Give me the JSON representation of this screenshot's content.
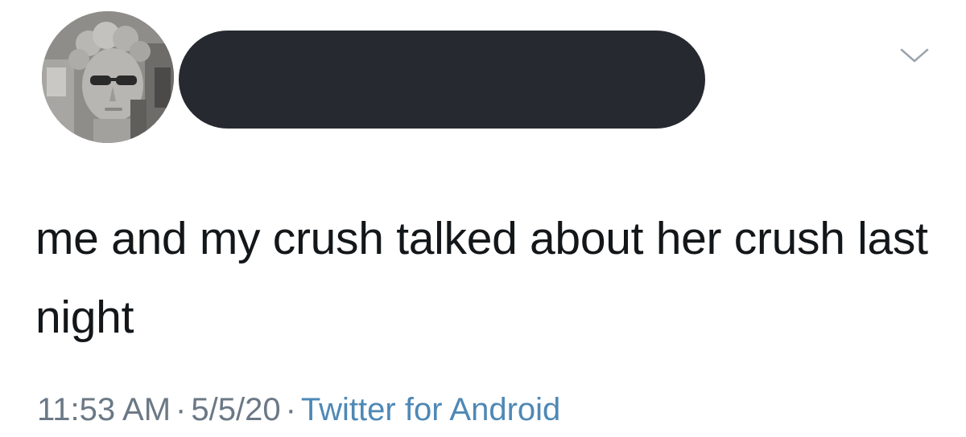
{
  "tweet": {
    "text": "me and my crush talked about her crush last night",
    "time": "11:53 AM",
    "date": "5/5/20",
    "separator": "·",
    "source": "Twitter for Android"
  },
  "header": {
    "avatar_icon": "statue-avatar",
    "menu_icon": "chevron-down-icon",
    "name_redaction_color": "#262a30"
  },
  "colors": {
    "text": "#14171a",
    "meta": "#6b7885",
    "link": "#4e88b5"
  }
}
